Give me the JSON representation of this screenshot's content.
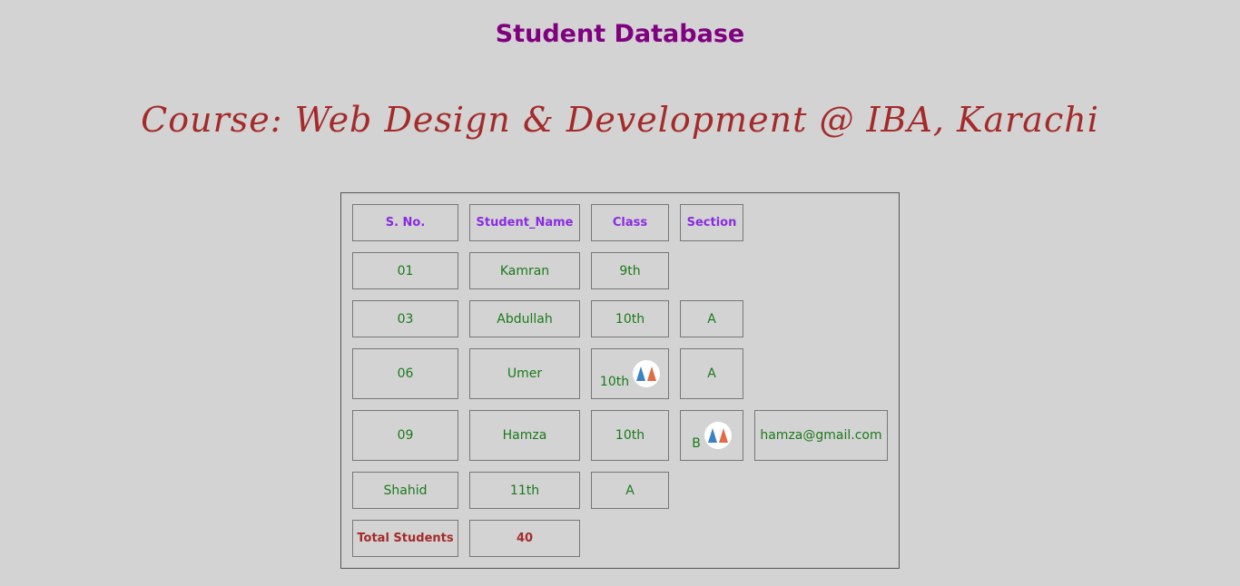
{
  "header": {
    "title": "Student Database",
    "course": "Course: Web Design & Development @ IBA, Karachi"
  },
  "table": {
    "headers": [
      "S. No.",
      "Student_Name",
      "Class",
      "Section"
    ],
    "rows": [
      [
        "01",
        "Kamran",
        "9th"
      ],
      [
        "03",
        "Abdullah",
        "10th",
        "A"
      ],
      [
        "06",
        "Umer",
        "10th",
        "A"
      ],
      [
        "09",
        "Hamza",
        "10th",
        "B",
        "hamza@gmail.com"
      ],
      [
        "Shahid",
        "11th",
        "A"
      ]
    ],
    "footer": {
      "label": "Total Students",
      "value": "40"
    }
  },
  "icons": [
    "emoji-icon"
  ],
  "colors": {
    "background": "#d3d3d3",
    "title": "#800080",
    "course": "#a52a2a",
    "header_text": "#8a2be2",
    "cell_text": "#1a7a1a",
    "footer_text": "#a52a2a"
  }
}
